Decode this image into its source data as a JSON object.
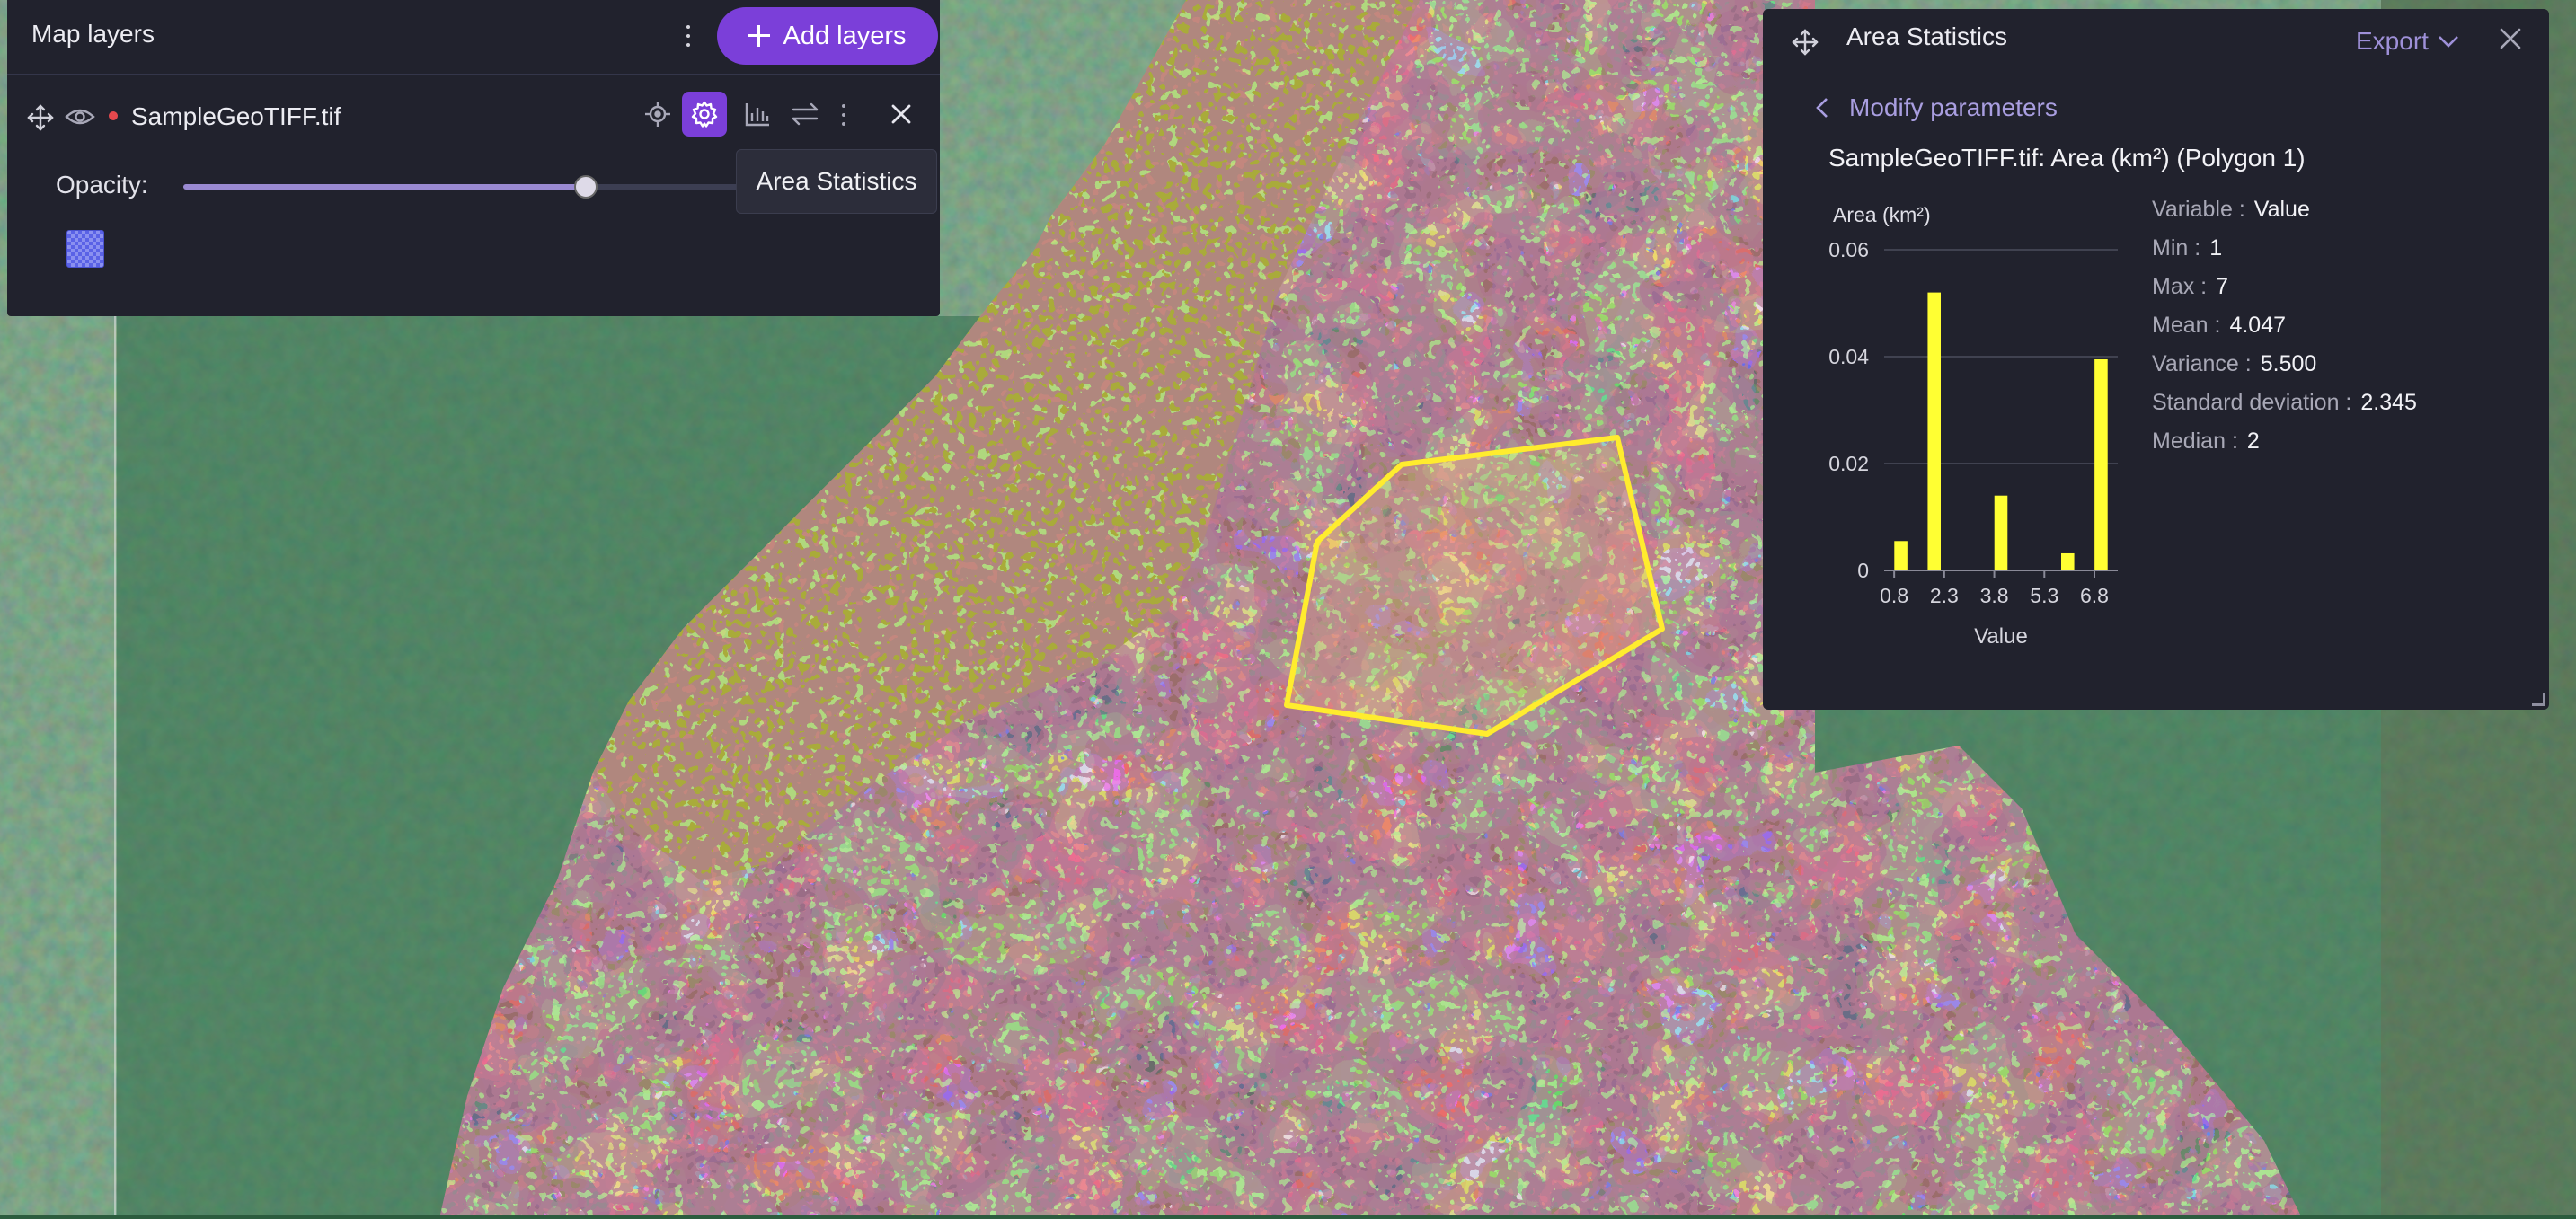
{
  "layers_panel": {
    "title": "Map layers",
    "add_button_label": "Add layers",
    "layer": {
      "name": "SampleGeoTIFF.tif"
    },
    "opacity_label": "Opacity:",
    "opacity_value": 0.72,
    "tooltip": "Area Statistics"
  },
  "stats_panel": {
    "title": "Area Statistics",
    "export_label": "Export",
    "modify_label": "Modify parameters",
    "heading": "SampleGeoTIFF.tif: Area (km²) (Polygon 1)",
    "stats": [
      {
        "key": "Variable",
        "value": "Value"
      },
      {
        "key": "Min",
        "value": "1"
      },
      {
        "key": "Max",
        "value": "7"
      },
      {
        "key": "Mean",
        "value": "4.047"
      },
      {
        "key": "Variance",
        "value": "5.500"
      },
      {
        "key": "Standard deviation",
        "value": "2.345"
      },
      {
        "key": "Median",
        "value": "2"
      }
    ]
  },
  "chart_data": {
    "type": "bar",
    "title": "",
    "ylabel": "Area (km²)",
    "xlabel": "Value",
    "ylim": [
      0,
      0.06
    ],
    "xlim": [
      0.5,
      7.5
    ],
    "yticks": [
      0,
      0.02,
      0.04,
      0.06
    ],
    "ytick_labels": [
      "0",
      "0.02",
      "0.04",
      "0.06"
    ],
    "xticks": [
      0.8,
      2.3,
      3.8,
      5.3,
      6.8
    ],
    "xtick_labels": [
      "0.8",
      "2.3",
      "3.8",
      "5.3",
      "6.8"
    ],
    "bin_width": 0.5,
    "bins": [
      {
        "x": 1,
        "value": 0.0055
      },
      {
        "x": 2,
        "value": 0.052
      },
      {
        "x": 4,
        "value": 0.014
      },
      {
        "x": 6,
        "value": 0.0032
      },
      {
        "x": 7,
        "value": 0.0395
      }
    ],
    "bar_color": "#ffff33",
    "grid": true
  },
  "colors": {
    "accent": "#7b3fd9",
    "panel_bg": "#21222d",
    "polygon": "#ffec2e"
  }
}
